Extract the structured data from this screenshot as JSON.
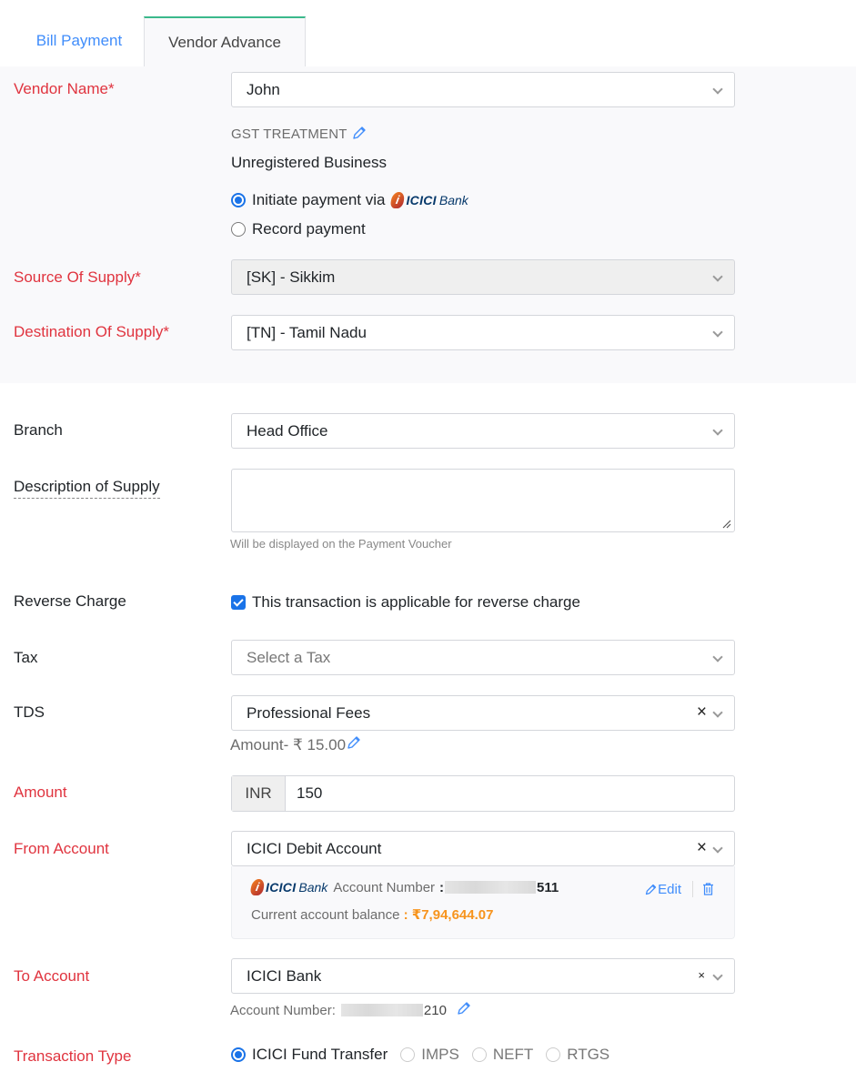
{
  "tabs": [
    {
      "label": "Bill Payment",
      "active": false
    },
    {
      "label": "Vendor Advance",
      "active": true
    }
  ],
  "form": {
    "vendor_name": {
      "label": "Vendor Name*",
      "value": "John"
    },
    "gst_treatment": {
      "label": "GST TREATMENT",
      "value": "Unregistered Business"
    },
    "payment_mode": {
      "options": [
        {
          "label": "Initiate payment via",
          "selected": true,
          "bank_logo": {
            "name": "ICICI",
            "suffix": "Bank"
          }
        },
        {
          "label": "Record payment",
          "selected": false
        }
      ]
    },
    "source_of_supply": {
      "label": "Source Of Supply*",
      "value": "[SK] - Sikkim"
    },
    "destination_of_supply": {
      "label": "Destination Of Supply*",
      "value": "[TN] - Tamil Nadu"
    },
    "branch": {
      "label": "Branch",
      "value": "Head Office"
    },
    "description": {
      "label": "Description of Supply",
      "value": "",
      "hint": "Will be displayed on the Payment Voucher"
    },
    "reverse_charge": {
      "label": "Reverse Charge",
      "checkbox_label": "This transaction is applicable for reverse charge",
      "checked": true
    },
    "tax": {
      "label": "Tax",
      "placeholder": "Select a Tax"
    },
    "tds": {
      "label": "TDS",
      "value": "Professional Fees",
      "amount_text": "Amount- ₹ 15.00"
    },
    "amount": {
      "label": "Amount",
      "currency": "INR",
      "value": "150"
    },
    "from_account": {
      "label": "From Account",
      "value": "ICICI Debit Account",
      "bank_logo": {
        "name": "ICICI",
        "suffix": "Bank"
      },
      "account_number_label": "Account Number",
      "account_number_colon": ":",
      "account_number_suffix": "511",
      "balance_label": "Current account balance",
      "balance_colon": ":",
      "balance_value": "₹7,94,644.07",
      "edit_label": "Edit"
    },
    "to_account": {
      "label": "To Account",
      "value": "ICICI Bank",
      "account_number_label": "Account Number:",
      "account_number_suffix": "210"
    },
    "transaction_type": {
      "label": "Transaction Type",
      "options": [
        {
          "label": "ICICI Fund Transfer",
          "selected": true
        },
        {
          "label": "IMPS",
          "selected": false
        },
        {
          "label": "NEFT",
          "selected": false
        },
        {
          "label": "RTGS",
          "selected": false
        }
      ]
    }
  },
  "colors": {
    "accent_blue": "#408dfb",
    "required_red": "#e0343f",
    "active_tab_border": "#3bb98b",
    "balance_orange": "#f7941d"
  }
}
